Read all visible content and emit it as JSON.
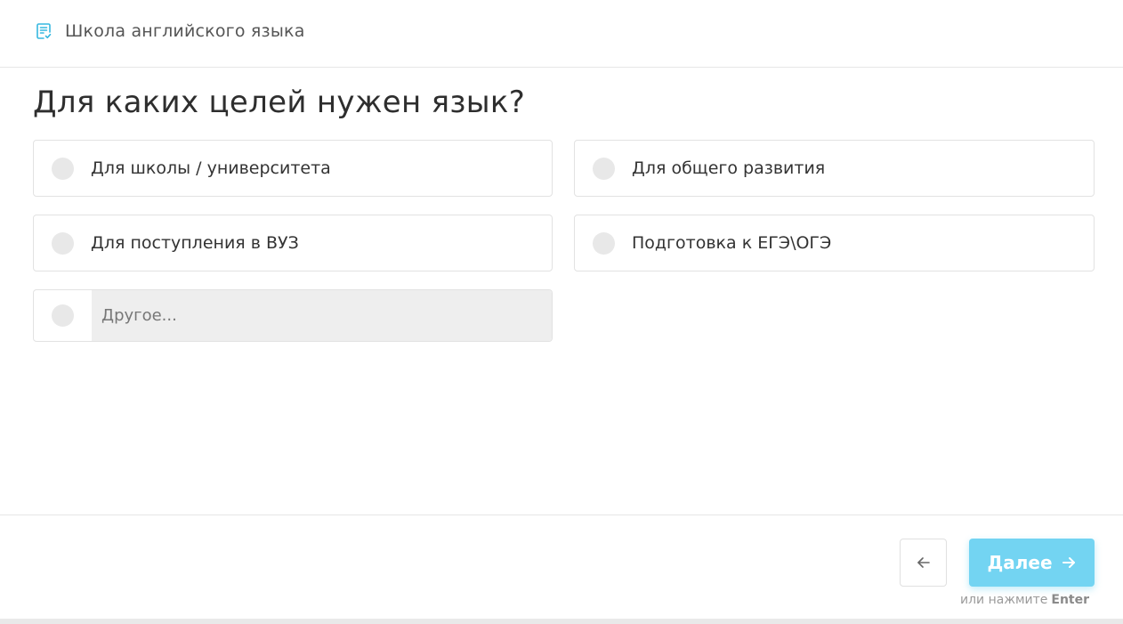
{
  "header": {
    "title": "Школа английского языка",
    "icon": "form-checklist-icon",
    "icon_color": "#36b8e0"
  },
  "question": {
    "title": "Для каких целей нужен язык?"
  },
  "options": [
    {
      "label": "Для школы / университета"
    },
    {
      "label": "Для общего развития"
    },
    {
      "label": "Для поступления в ВУЗ"
    },
    {
      "label": "Подготовка к ЕГЭ\\ОГЭ"
    }
  ],
  "other": {
    "placeholder": "Другое..."
  },
  "footer": {
    "next_label": "Далее",
    "hint_prefix": "или нажмите",
    "hint_key": "Enter",
    "accent_color": "#73d4f2"
  }
}
